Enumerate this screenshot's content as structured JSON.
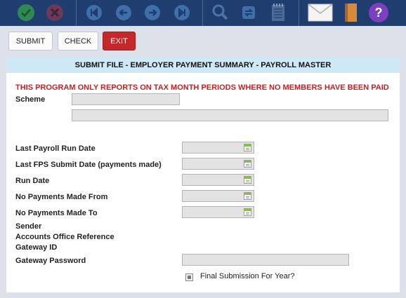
{
  "toolbar": {
    "icons": [
      "check-icon",
      "cancel-icon",
      "first-record-icon",
      "previous-record-icon",
      "next-record-icon",
      "last-record-icon",
      "search-icon",
      "refresh-icon",
      "notepad-icon",
      "mail-icon",
      "book-icon",
      "help-icon"
    ],
    "help_glyph": "?"
  },
  "buttons": {
    "submit": "SUBMIT",
    "check": "CHECK",
    "exit": "EXIT"
  },
  "colors": {
    "toolbar": "#1f3d6e",
    "header": "#cfe8f6",
    "warning": "#cc1f1f",
    "exit_button": "#c5282a"
  },
  "panel": {
    "title": "SUBMIT FILE - EMPLOYER PAYMENT SUMMARY - PAYROLL MASTER",
    "warning": "THIS PROGRAM ONLY REPORTS ON TAX MONTH PERIODS WHERE NO MEMBERS HAVE BEEN PAID",
    "fields": {
      "scheme": {
        "label": "Scheme",
        "value": "",
        "description": ""
      },
      "last_payroll_run_date": {
        "label": "Last Payroll Run Date",
        "value": ""
      },
      "last_fps_submit_date": {
        "label": "Last FPS Submit Date (payments made)",
        "value": ""
      },
      "run_date": {
        "label": "Run Date",
        "value": ""
      },
      "no_payments_from": {
        "label": "No Payments Made From",
        "value": ""
      },
      "no_payments_to": {
        "label": "No Payments Made To",
        "value": ""
      },
      "sender": {
        "label": "Sender"
      },
      "accounts_office_reference": {
        "label": "Accounts Office Reference"
      },
      "gateway_id": {
        "label": "Gateway ID"
      },
      "gateway_password": {
        "label": "Gateway Password",
        "value": ""
      },
      "final_submission": {
        "label": "Final Submission For Year?",
        "checked": false
      }
    }
  }
}
